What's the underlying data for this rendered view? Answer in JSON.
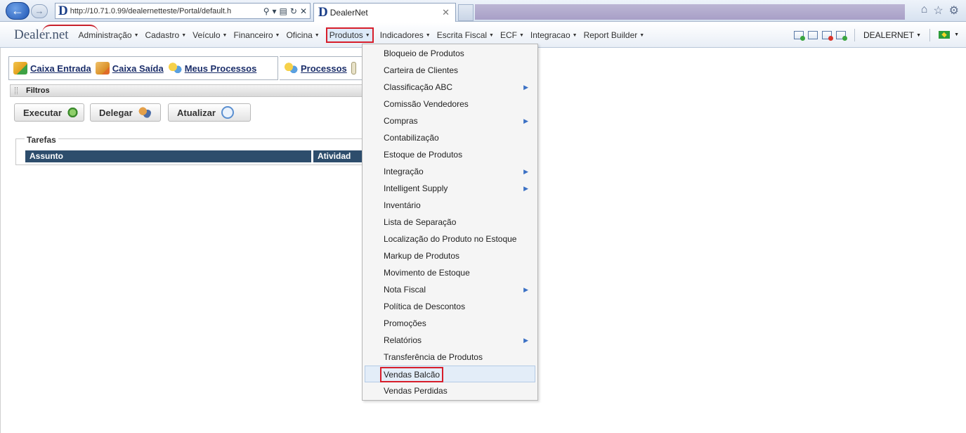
{
  "browser": {
    "url": "http://10.71.0.99/dealernetteste/Portal/default.h",
    "tab_title": "DealerNet",
    "site_letter": "D"
  },
  "app": {
    "brand": "Dealer.net",
    "menu": [
      {
        "label": "Administração",
        "active": false
      },
      {
        "label": "Cadastro",
        "active": false
      },
      {
        "label": "Veículo",
        "active": false
      },
      {
        "label": "Financeiro",
        "active": false
      },
      {
        "label": "Oficina",
        "active": false
      },
      {
        "label": "Produtos",
        "active": true
      },
      {
        "label": "Indicadores",
        "active": false
      },
      {
        "label": "Escrita Fiscal",
        "active": false
      },
      {
        "label": "ECF",
        "active": false
      },
      {
        "label": "Integracao",
        "active": false
      },
      {
        "label": "Report Builder",
        "active": false
      }
    ],
    "user": "DEALERNET"
  },
  "toolbar": {
    "caixa_entrada": "Caixa Entrada",
    "caixa_saida": "Caixa Saída",
    "meus_processos": "Meus Processos",
    "processos": "Processos"
  },
  "filters": {
    "title": "Filtros"
  },
  "buttons": {
    "executar": "Executar",
    "delegar": "Delegar",
    "atualizar": "Atualizar"
  },
  "tarefas": {
    "title": "Tarefas",
    "col_assunto": "Assunto",
    "col_atividade": "Atividad"
  },
  "dropdown": {
    "items": [
      {
        "label": "Bloqueio de Produtos",
        "submenu": false
      },
      {
        "label": "Carteira de Clientes",
        "submenu": false
      },
      {
        "label": "Classificação ABC",
        "submenu": true
      },
      {
        "label": "Comissão Vendedores",
        "submenu": false
      },
      {
        "label": "Compras",
        "submenu": true
      },
      {
        "label": "Contabilização",
        "submenu": false
      },
      {
        "label": "Estoque de Produtos",
        "submenu": false
      },
      {
        "label": "Integração",
        "submenu": true
      },
      {
        "label": "Intelligent Supply",
        "submenu": true
      },
      {
        "label": "Inventário",
        "submenu": false
      },
      {
        "label": "Lista de Separação",
        "submenu": false
      },
      {
        "label": "Localização do Produto no Estoque",
        "submenu": false
      },
      {
        "label": "Markup de Produtos",
        "submenu": false
      },
      {
        "label": "Movimento de Estoque",
        "submenu": false
      },
      {
        "label": "Nota Fiscal",
        "submenu": true
      },
      {
        "label": "Política de Descontos",
        "submenu": false
      },
      {
        "label": "Promoções",
        "submenu": false
      },
      {
        "label": "Relatórios",
        "submenu": true
      },
      {
        "label": "Transferência de Produtos",
        "submenu": false
      },
      {
        "label": "Vendas Balcão",
        "submenu": false,
        "hover": true
      },
      {
        "label": "Vendas Perdidas",
        "submenu": false
      }
    ]
  }
}
